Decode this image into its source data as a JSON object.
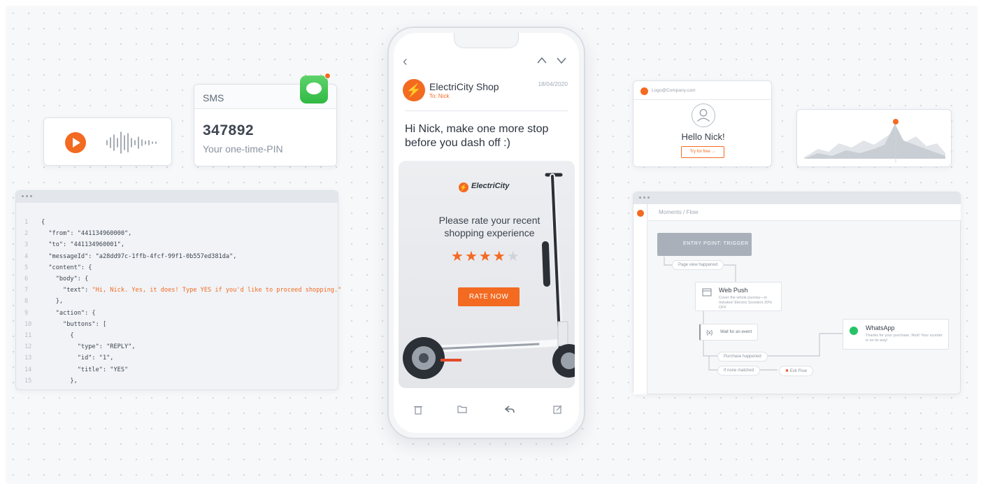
{
  "sms": {
    "title": "SMS",
    "code": "347892",
    "subtitle": "Your one-time-PIN"
  },
  "code_window": {
    "lines": [
      {
        "n": "1",
        "text": "{"
      },
      {
        "n": "2",
        "text": "  \"from\": \"441134960000\","
      },
      {
        "n": "3",
        "text": "  \"to\": \"441134960001\","
      },
      {
        "n": "4",
        "text": "  \"messageId\": \"a28dd97c-1ffb-4fcf-99f1-0b557ed381da\","
      },
      {
        "n": "5",
        "text": "  \"content\": {"
      },
      {
        "n": "6",
        "text": "    \"body\": {"
      },
      {
        "n": "7",
        "key": "      \"text\": ",
        "value": "\"Hi, Nick. Yes, it does! Type YES if you'd like to proceed shopping.\""
      },
      {
        "n": "8",
        "text": "    },"
      },
      {
        "n": "9",
        "text": "    \"action\": {"
      },
      {
        "n": "10",
        "text": "      \"buttons\": ["
      },
      {
        "n": "11",
        "text": "        {"
      },
      {
        "n": "12",
        "text": "          \"type\": \"REPLY\","
      },
      {
        "n": "13",
        "text": "          \"id\": \"1\","
      },
      {
        "n": "14",
        "text": "          \"title\": \"YES\""
      },
      {
        "n": "15",
        "text": "        },"
      }
    ]
  },
  "phone": {
    "sender": "ElectriCity Shop",
    "to": "To: Nick",
    "date": "18/04/2020",
    "message": "Hi Nick, make one more stop before you dash off :)",
    "promo": {
      "brand": "ElectriCity",
      "text": "Please rate your recent shopping experience",
      "rating": 4,
      "max_rating": 5,
      "button": "RATE NOW"
    }
  },
  "profile_card": {
    "email": "Logo@Company.com",
    "greeting": "Hello Nick!",
    "button": "Try for free →"
  },
  "flow": {
    "breadcrumb": "Moments / Flow",
    "entry": "ENTRY POINT: TRIGGER",
    "page_view": "Page view happened",
    "web_push_title": "Web Push",
    "web_push_sub": "Cover the whole journey—in minutes! Electric Scooters 20% OFF",
    "wait": "Wait for an event",
    "wait_code": "{x}",
    "purchase": "Purchase happened",
    "if_none": "If none matched",
    "exit": "Exit Flow",
    "whatsapp_title": "WhatsApp",
    "whatsapp_sub": "Thanks for your purchase, Nick! Your scooter is on its way!"
  },
  "colors": {
    "accent": "#f36a21",
    "sms_green": "#30b944",
    "whatsapp": "#25c366"
  }
}
